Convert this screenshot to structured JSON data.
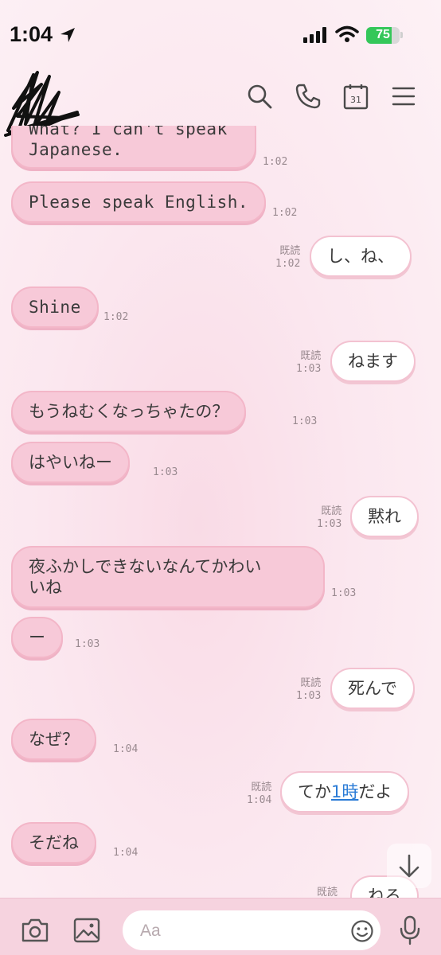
{
  "status_bar": {
    "time": "1:04",
    "battery_level": 75,
    "battery_label": "75"
  },
  "header": {
    "icons": [
      "search-icon",
      "phone-icon",
      "calendar-icon",
      "menu-icon"
    ],
    "calendar_day": "31"
  },
  "messages": [
    {
      "side": "in",
      "text": "What? I can't speak\nJapanese.",
      "time": "1:02"
    },
    {
      "side": "in",
      "text": "Please speak English.",
      "time": "1:02"
    },
    {
      "side": "out",
      "text": "し、ね、",
      "read": "既読",
      "time": "1:02"
    },
    {
      "side": "in",
      "text": "Shine",
      "time": "1:02"
    },
    {
      "side": "out",
      "text": "ねます",
      "read": "既読",
      "time": "1:03"
    },
    {
      "side": "in",
      "text": "もうねむくなっちゃたの？",
      "time": "1:03"
    },
    {
      "side": "in",
      "text": "はやいねー",
      "time": "1:03"
    },
    {
      "side": "out",
      "text": "黙れ",
      "read": "既読",
      "time": "1:03"
    },
    {
      "side": "in",
      "text": "夜ふかしできないなんてかわい\nいね",
      "time": "1:03"
    },
    {
      "side": "in",
      "text": "ー",
      "time": "1:03"
    },
    {
      "side": "out",
      "text": "死んで",
      "read": "既読",
      "time": "1:03"
    },
    {
      "side": "in",
      "text": "なぜ？",
      "time": "1:04"
    },
    {
      "side": "out",
      "text_before": "てか",
      "text_link": "1時",
      "text_after": "だよ",
      "read": "既読",
      "time": "1:04"
    },
    {
      "side": "in",
      "text": "そだね",
      "time": "1:04"
    },
    {
      "side": "out",
      "text": "ねろ",
      "read": "既読",
      "time": ""
    }
  ],
  "input": {
    "placeholder": "Aa"
  },
  "colors": {
    "incoming_bubble": "#f7c9d8",
    "outgoing_bubble": "#ffffff",
    "link": "#2a7bd6",
    "background": "#fbe6ee"
  }
}
